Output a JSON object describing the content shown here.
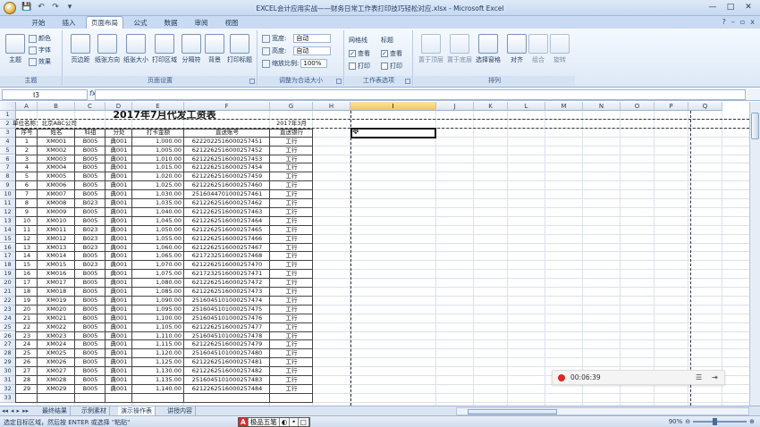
{
  "window": {
    "title": "EXCEL会计应用实战——财务日常工作表打印技巧轻松对应.xlsx - Microsoft Excel",
    "controls": [
      "—",
      "□",
      "✕"
    ]
  },
  "quick_access": [
    "💾",
    "↶",
    "↷",
    "▾"
  ],
  "ribbon_tabs": [
    "开始",
    "插入",
    "页面布局",
    "公式",
    "数据",
    "审阅",
    "视图"
  ],
  "active_tab": "页面布局",
  "ribbon": {
    "themes": {
      "label": "主题",
      "big": "主题",
      "colors": "颜色",
      "fonts": "字体",
      "effects": "效果"
    },
    "page_setup": {
      "label": "页面设置",
      "buttons": [
        "页边距",
        "纸张方向",
        "纸张大小",
        "打印区域",
        "分隔符",
        "背景",
        "打印标题"
      ]
    },
    "scale": {
      "label": "调整为合适大小",
      "width_label": "宽度:",
      "width_value": "自动",
      "height_label": "高度:",
      "height_value": "自动",
      "scale_label": "缩放比例:",
      "scale_value": "100%"
    },
    "sheet_options": {
      "label": "工作表选项",
      "gridlines": "网格线",
      "headings": "标题",
      "view": "查看",
      "print": "打印",
      "view_mark": "✓",
      "print_mark": ""
    },
    "arrange": {
      "label": "排列",
      "buttons": [
        "置于顶层",
        "置于底层",
        "选择窗格",
        "对齐",
        "组合",
        "旋转"
      ]
    }
  },
  "formula_bar": {
    "name_box": "I3",
    "fx": "fx",
    "content": ""
  },
  "columns": [
    "A",
    "B",
    "C",
    "D",
    "E",
    "F",
    "G",
    "H",
    "I",
    "J",
    "K",
    "L",
    "M",
    "N",
    "O",
    "P",
    "Q"
  ],
  "selected_column": "I",
  "sheet": {
    "title": "2017年7月代发工资表",
    "unit_label": "单位名称：北京ABC公司",
    "date_label": "2017年3月",
    "headers": [
      "序号",
      "姓名",
      "科组",
      "分处",
      "打卡金额",
      "直送账号",
      "直送银行"
    ],
    "rows": [
      [
        "1",
        "XM001",
        "B005",
        "典001",
        "1,000.00",
        "6222022516000257451",
        "工行"
      ],
      [
        "2",
        "XM002",
        "B005",
        "典001",
        "1,005.00",
        "6212262516000257452",
        "工行"
      ],
      [
        "3",
        "XM003",
        "B005",
        "典001",
        "1,010.00",
        "6212262516000257453",
        "工行"
      ],
      [
        "4",
        "XM004",
        "B005",
        "典001",
        "1,015.00",
        "6212262516000257454",
        "工行"
      ],
      [
        "5",
        "XM005",
        "B005",
        "典001",
        "1,020.00",
        "6212262516000257459",
        "工行"
      ],
      [
        "6",
        "XM006",
        "B005",
        "典001",
        "1,025.00",
        "6212262516000257460",
        "工行"
      ],
      [
        "7",
        "XM007",
        "B005",
        "典001",
        "1,030.00",
        "2516044701000257461",
        "工行"
      ],
      [
        "8",
        "XM008",
        "B023",
        "典001",
        "1,035.00",
        "6212262516000257462",
        "工行"
      ],
      [
        "9",
        "XM009",
        "B005",
        "典001",
        "1,040.00",
        "6212262516000257463",
        "工行"
      ],
      [
        "10",
        "XM010",
        "B005",
        "典001",
        "1,045.00",
        "6212262516000257464",
        "工行"
      ],
      [
        "11",
        "XM011",
        "B023",
        "典001",
        "1,050.00",
        "6212262516000257465",
        "工行"
      ],
      [
        "12",
        "XM012",
        "B023",
        "典001",
        "1,055.00",
        "6212262516000257466",
        "工行"
      ],
      [
        "13",
        "XM013",
        "B023",
        "典001",
        "1,060.00",
        "6212262516000257467",
        "工行"
      ],
      [
        "14",
        "XM014",
        "B005",
        "典001",
        "1,065.00",
        "6217232516000257468",
        "工行"
      ],
      [
        "15",
        "XM015",
        "B023",
        "典001",
        "1,070.00",
        "6212262516000257470",
        "工行"
      ],
      [
        "16",
        "XM016",
        "B005",
        "典001",
        "1,075.00",
        "6217232516000257471",
        "工行"
      ],
      [
        "17",
        "XM017",
        "B005",
        "典001",
        "1,080.00",
        "6212262516000257472",
        "工行"
      ],
      [
        "18",
        "XM018",
        "B005",
        "典001",
        "1,085.00",
        "6212262516000257473",
        "工行"
      ],
      [
        "19",
        "XM019",
        "B005",
        "典001",
        "1,090.00",
        "2516045101000257474",
        "工行"
      ],
      [
        "20",
        "XM020",
        "B005",
        "典001",
        "1,095.00",
        "2516045101000257475",
        "工行"
      ],
      [
        "21",
        "XM021",
        "B005",
        "典001",
        "1,100.00",
        "2516045101000257476",
        "工行"
      ],
      [
        "22",
        "XM022",
        "B005",
        "典001",
        "1,105.00",
        "6212262516000257477",
        "工行"
      ],
      [
        "23",
        "XM023",
        "B005",
        "典001",
        "1,110.00",
        "2516045101000257478",
        "工行"
      ],
      [
        "24",
        "XM024",
        "B005",
        "典001",
        "1,115.00",
        "6212262516000257479",
        "工行"
      ],
      [
        "25",
        "XM025",
        "B005",
        "典001",
        "1,120.00",
        "2516045101000257480",
        "工行"
      ],
      [
        "26",
        "XM026",
        "B005",
        "典001",
        "1,125.00",
        "6212262516000257481",
        "工行"
      ],
      [
        "27",
        "XM027",
        "B005",
        "典001",
        "1,130.00",
        "6212262516000257482",
        "工行"
      ],
      [
        "28",
        "XM028",
        "B005",
        "典001",
        "1,135.00",
        "2516045101000257483",
        "工行"
      ],
      [
        "29",
        "XM029",
        "B005",
        "典001",
        "1,140.00",
        "6212262516000257484",
        "工行"
      ]
    ]
  },
  "sheet_tabs": [
    "最终结果",
    "示例素材",
    "演示操作表",
    "讲授内容"
  ],
  "status": {
    "message": "选定目标区域，然后按 ENTER 或选择 \"粘贴\"",
    "zoom": "90%"
  },
  "ime": [
    "极品五笔",
    "◐",
    "•",
    "□"
  ],
  "recorder": {
    "time": "00:06:39"
  }
}
